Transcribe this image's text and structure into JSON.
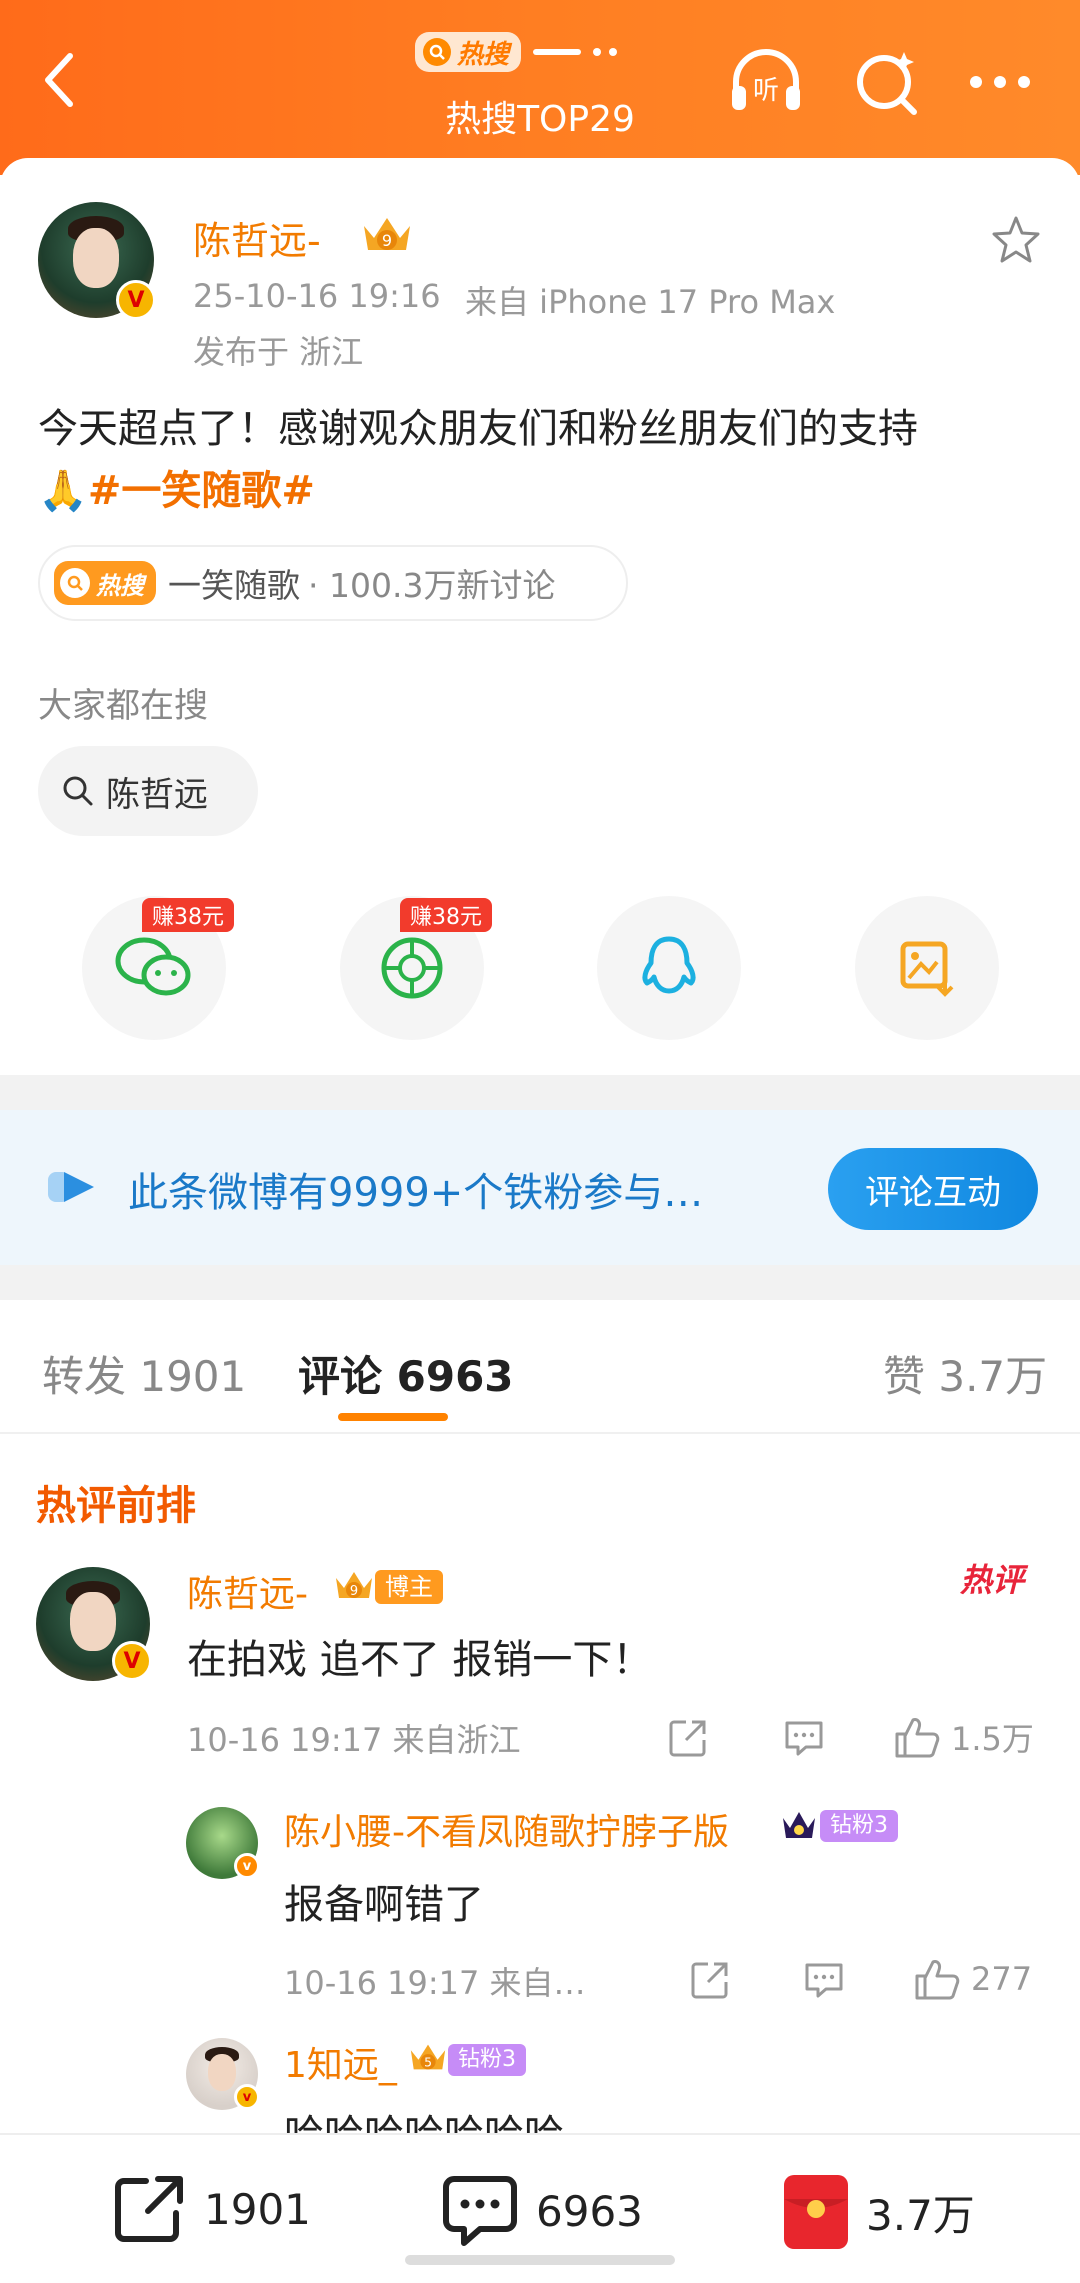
{
  "header": {
    "hot_badge": "热搜",
    "title": "热搜TOP29",
    "listen_label": "听"
  },
  "post": {
    "author": "陈哲远-",
    "level": "9",
    "timestamp": "25-10-16 19:16",
    "source": "来自 iPhone 17 Pro Max",
    "location": "发布于 浙江",
    "text": "今天超点了！感谢观众朋友们和粉丝朋友们的支持",
    "emoji": "🙏",
    "topic": "#一笑随歌#"
  },
  "hot_chip": {
    "badge": "热搜",
    "name": "一笑随歌",
    "discussion": "· 100.3万新讨论"
  },
  "search": {
    "section_label": "大家都在搜",
    "term": "陈哲远"
  },
  "share": {
    "earn_label_1": "赚38元",
    "earn_label_2": "赚38元"
  },
  "fans": {
    "text": "此条微博有9999+个铁粉参与…",
    "button": "评论互动"
  },
  "tabs": {
    "repost": "转发 1901",
    "comment": "评论 6963",
    "like": "赞 3.7万"
  },
  "comments": {
    "section_label": "热评前排",
    "hot_tag": "热评",
    "main": {
      "name": "陈哲远-",
      "level": "9",
      "role_tag": "博主",
      "text": "在拍戏 追不了 报销一下！",
      "meta": "10-16 19:17  来自浙江",
      "likes": "1.5万"
    },
    "replies": [
      {
        "name": "陈小腰-不看凤随歌拧脖子版",
        "fan_tag": "钻粉3",
        "text": "报备啊错了",
        "meta": "10-16 19:17  来自…",
        "likes": "277"
      },
      {
        "name": "1知远_",
        "level": "5",
        "fan_tag": "钻粉3",
        "text": "哈哈哈哈哈哈哈"
      }
    ]
  },
  "bottom_bar": {
    "reposts": "1901",
    "comments": "6963",
    "likes": "3.7万"
  },
  "colors": {
    "accent": "#ff7a1a",
    "username": "#f27b00",
    "link_blue": "#1a79c8"
  }
}
